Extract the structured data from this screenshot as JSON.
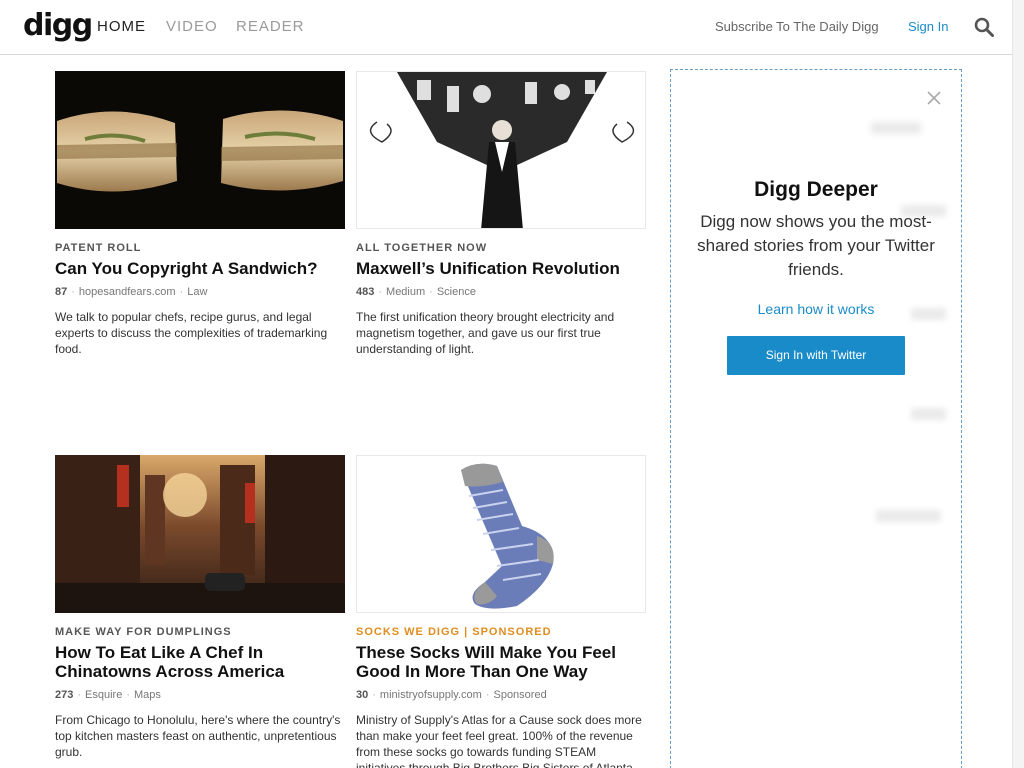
{
  "header": {
    "logo": "digg",
    "nav": [
      "HOME",
      "VIDEO",
      "READER"
    ],
    "subscribe": "Subscribe To The Daily Digg",
    "signin": "Sign In"
  },
  "articles": [
    {
      "kicker": "PATENT ROLL",
      "title": "Can You Copyright A Sandwich?",
      "count": "87",
      "source": "hopesandfears.com",
      "tag": "Law",
      "desc": "We talk to popular chefs, recipe gurus, and legal experts to discuss the complexities of trademarking food."
    },
    {
      "kicker": "ALL TOGETHER NOW",
      "title": "Maxwell’s Unification Revolution",
      "count": "483",
      "source": "Medium",
      "tag": "Science",
      "desc": "The first unification theory brought electricity and magnetism together, and gave us our first true understanding of light."
    },
    {
      "kicker": "MAKE WAY FOR DUMPLINGS",
      "title": "How To Eat Like A Chef In Chinatowns Across America",
      "count": "273",
      "source": "Esquire",
      "tag": "Maps",
      "desc": "From Chicago to Honolulu, here's where the country's top kitchen masters feast on authentic, unpretentious grub."
    },
    {
      "kicker": "SOCKS WE DIGG | SPONSORED",
      "title": "These Socks Will Make You Feel Good In More Than One Way",
      "count": "30",
      "source": "ministryofsupply.com",
      "tag": "Sponsored",
      "desc": "Ministry of Supply's Atlas for a Cause sock does more than make your feet feel great. 100% of the revenue from these socks go towards funding STEAM initiatives through Big Brothers Big Sisters of Atlanta."
    }
  ],
  "sidebar": {
    "title": "Digg Deeper",
    "text": "Digg now shows you the most-shared stories from your Twitter friends.",
    "link": "Learn how it works",
    "button": "Sign In with Twitter"
  },
  "colors": {
    "accent": "#1a8bc9",
    "sponsored": "#e08c1e",
    "text": "#111111",
    "muted": "#777777"
  }
}
